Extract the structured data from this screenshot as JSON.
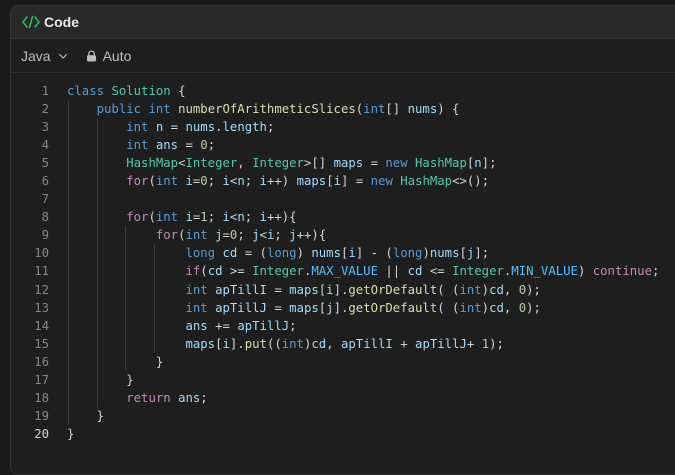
{
  "header": {
    "title": "Code",
    "icon": "code-brackets-icon",
    "icon_color": "#2cbb5d"
  },
  "toolbar": {
    "language": "Java",
    "mode": "Auto"
  },
  "colors": {
    "keyword": "#569cd6",
    "type": "#4ec9b0",
    "function": "#dcdcaa",
    "variable": "#9cdcfe",
    "number": "#b5cea8",
    "control": "#c586c0"
  },
  "editor": {
    "active_line": 20,
    "lines": [
      {
        "n": "1",
        "indent": 0,
        "tokens": [
          [
            "kw",
            "class"
          ],
          [
            "pl",
            " "
          ],
          [
            "ty",
            "Solution"
          ],
          [
            "pl",
            " {"
          ]
        ]
      },
      {
        "n": "2",
        "indent": 1,
        "tokens": [
          [
            "kw",
            "public"
          ],
          [
            "pl",
            " "
          ],
          [
            "kw",
            "int"
          ],
          [
            "pl",
            " "
          ],
          [
            "fn",
            "numberOfArithmeticSlices"
          ],
          [
            "pl",
            "("
          ],
          [
            "kw",
            "int"
          ],
          [
            "pl",
            "[] "
          ],
          [
            "va",
            "nums"
          ],
          [
            "pl",
            ") {"
          ]
        ]
      },
      {
        "n": "3",
        "indent": 2,
        "tokens": [
          [
            "kw",
            "int"
          ],
          [
            "pl",
            " "
          ],
          [
            "va",
            "n"
          ],
          [
            "pl",
            " = "
          ],
          [
            "va",
            "nums"
          ],
          [
            "pl",
            "."
          ],
          [
            "va",
            "length"
          ],
          [
            "pl",
            ";"
          ]
        ]
      },
      {
        "n": "4",
        "indent": 2,
        "tokens": [
          [
            "kw",
            "int"
          ],
          [
            "pl",
            " "
          ],
          [
            "va",
            "ans"
          ],
          [
            "pl",
            " = "
          ],
          [
            "nu",
            "0"
          ],
          [
            "pl",
            ";"
          ]
        ]
      },
      {
        "n": "5",
        "indent": 2,
        "tokens": [
          [
            "ty",
            "HashMap"
          ],
          [
            "pl",
            "<"
          ],
          [
            "ty",
            "Integer"
          ],
          [
            "pl",
            ", "
          ],
          [
            "ty",
            "Integer"
          ],
          [
            "pl",
            ">[] "
          ],
          [
            "va",
            "maps"
          ],
          [
            "pl",
            " = "
          ],
          [
            "kw",
            "new"
          ],
          [
            "pl",
            " "
          ],
          [
            "ty",
            "HashMap"
          ],
          [
            "pl",
            "["
          ],
          [
            "va",
            "n"
          ],
          [
            "pl",
            "];"
          ]
        ]
      },
      {
        "n": "6",
        "indent": 2,
        "tokens": [
          [
            "ct",
            "for"
          ],
          [
            "pl",
            "("
          ],
          [
            "kw",
            "int"
          ],
          [
            "pl",
            " "
          ],
          [
            "va",
            "i"
          ],
          [
            "pl",
            "="
          ],
          [
            "nu",
            "0"
          ],
          [
            "pl",
            "; "
          ],
          [
            "va",
            "i"
          ],
          [
            "pl",
            "<"
          ],
          [
            "va",
            "n"
          ],
          [
            "pl",
            "; "
          ],
          [
            "va",
            "i"
          ],
          [
            "pl",
            "++) "
          ],
          [
            "va",
            "maps"
          ],
          [
            "pl",
            "["
          ],
          [
            "va",
            "i"
          ],
          [
            "pl",
            "] = "
          ],
          [
            "kw",
            "new"
          ],
          [
            "pl",
            " "
          ],
          [
            "ty",
            "HashMap"
          ],
          [
            "pl",
            "<>();"
          ]
        ]
      },
      {
        "n": "7",
        "indent": 2,
        "tokens": []
      },
      {
        "n": "8",
        "indent": 2,
        "tokens": [
          [
            "ct",
            "for"
          ],
          [
            "pl",
            "("
          ],
          [
            "kw",
            "int"
          ],
          [
            "pl",
            " "
          ],
          [
            "va",
            "i"
          ],
          [
            "pl",
            "="
          ],
          [
            "nu",
            "1"
          ],
          [
            "pl",
            "; "
          ],
          [
            "va",
            "i"
          ],
          [
            "pl",
            "<"
          ],
          [
            "va",
            "n"
          ],
          [
            "pl",
            "; "
          ],
          [
            "va",
            "i"
          ],
          [
            "pl",
            "++){"
          ]
        ]
      },
      {
        "n": "9",
        "indent": 3,
        "tokens": [
          [
            "ct",
            "for"
          ],
          [
            "pl",
            "("
          ],
          [
            "kw",
            "int"
          ],
          [
            "pl",
            " "
          ],
          [
            "va",
            "j"
          ],
          [
            "pl",
            "="
          ],
          [
            "nu",
            "0"
          ],
          [
            "pl",
            "; "
          ],
          [
            "va",
            "j"
          ],
          [
            "pl",
            "<"
          ],
          [
            "va",
            "i"
          ],
          [
            "pl",
            "; "
          ],
          [
            "va",
            "j"
          ],
          [
            "pl",
            "++){"
          ]
        ]
      },
      {
        "n": "10",
        "indent": 4,
        "tokens": [
          [
            "kw",
            "long"
          ],
          [
            "pl",
            " "
          ],
          [
            "va",
            "cd"
          ],
          [
            "pl",
            " = ("
          ],
          [
            "kw",
            "long"
          ],
          [
            "pl",
            ") "
          ],
          [
            "va",
            "nums"
          ],
          [
            "pl",
            "["
          ],
          [
            "va",
            "i"
          ],
          [
            "pl",
            "] - ("
          ],
          [
            "kw",
            "long"
          ],
          [
            "pl",
            ")"
          ],
          [
            "va",
            "nums"
          ],
          [
            "pl",
            "["
          ],
          [
            "va",
            "j"
          ],
          [
            "pl",
            "];"
          ]
        ]
      },
      {
        "n": "11",
        "indent": 4,
        "tokens": [
          [
            "ct",
            "if"
          ],
          [
            "pl",
            "("
          ],
          [
            "va",
            "cd"
          ],
          [
            "pl",
            " >= "
          ],
          [
            "ty",
            "Integer"
          ],
          [
            "pl",
            "."
          ],
          [
            "co",
            "MAX_VALUE"
          ],
          [
            "pl",
            " || "
          ],
          [
            "va",
            "cd"
          ],
          [
            "pl",
            " <= "
          ],
          [
            "ty",
            "Integer"
          ],
          [
            "pl",
            "."
          ],
          [
            "co",
            "MIN_VALUE"
          ],
          [
            "pl",
            ") "
          ],
          [
            "ct",
            "continue"
          ],
          [
            "pl",
            ";"
          ]
        ]
      },
      {
        "n": "12",
        "indent": 4,
        "tokens": [
          [
            "kw",
            "int"
          ],
          [
            "pl",
            " "
          ],
          [
            "va",
            "apTillI"
          ],
          [
            "pl",
            " = "
          ],
          [
            "va",
            "maps"
          ],
          [
            "pl",
            "["
          ],
          [
            "va",
            "i"
          ],
          [
            "pl",
            "]."
          ],
          [
            "fn",
            "getOrDefault"
          ],
          [
            "pl",
            "( ("
          ],
          [
            "kw",
            "int"
          ],
          [
            "pl",
            ")"
          ],
          [
            "va",
            "cd"
          ],
          [
            "pl",
            ", "
          ],
          [
            "nu",
            "0"
          ],
          [
            "pl",
            ");"
          ]
        ]
      },
      {
        "n": "13",
        "indent": 4,
        "tokens": [
          [
            "kw",
            "int"
          ],
          [
            "pl",
            " "
          ],
          [
            "va",
            "apTillJ"
          ],
          [
            "pl",
            " = "
          ],
          [
            "va",
            "maps"
          ],
          [
            "pl",
            "["
          ],
          [
            "va",
            "j"
          ],
          [
            "pl",
            "]."
          ],
          [
            "fn",
            "getOrDefault"
          ],
          [
            "pl",
            "( ("
          ],
          [
            "kw",
            "int"
          ],
          [
            "pl",
            ")"
          ],
          [
            "va",
            "cd"
          ],
          [
            "pl",
            ", "
          ],
          [
            "nu",
            "0"
          ],
          [
            "pl",
            ");"
          ]
        ]
      },
      {
        "n": "14",
        "indent": 4,
        "tokens": [
          [
            "va",
            "ans"
          ],
          [
            "pl",
            " += "
          ],
          [
            "va",
            "apTillJ"
          ],
          [
            "pl",
            ";"
          ]
        ]
      },
      {
        "n": "15",
        "indent": 4,
        "tokens": [
          [
            "va",
            "maps"
          ],
          [
            "pl",
            "["
          ],
          [
            "va",
            "i"
          ],
          [
            "pl",
            "]."
          ],
          [
            "fn",
            "put"
          ],
          [
            "pl",
            "(("
          ],
          [
            "kw",
            "int"
          ],
          [
            "pl",
            ")"
          ],
          [
            "va",
            "cd"
          ],
          [
            "pl",
            ", "
          ],
          [
            "va",
            "apTillI"
          ],
          [
            "pl",
            " + "
          ],
          [
            "va",
            "apTillJ"
          ],
          [
            "pl",
            "+ "
          ],
          [
            "nu",
            "1"
          ],
          [
            "pl",
            ");"
          ]
        ]
      },
      {
        "n": "16",
        "indent": 3,
        "tokens": [
          [
            "pl",
            "}"
          ]
        ]
      },
      {
        "n": "17",
        "indent": 2,
        "tokens": [
          [
            "pl",
            "}"
          ]
        ]
      },
      {
        "n": "18",
        "indent": 2,
        "tokens": [
          [
            "ct",
            "return"
          ],
          [
            "pl",
            " "
          ],
          [
            "va",
            "ans"
          ],
          [
            "pl",
            ";"
          ]
        ]
      },
      {
        "n": "19",
        "indent": 1,
        "tokens": [
          [
            "pl",
            "}"
          ]
        ]
      },
      {
        "n": "20",
        "indent": 0,
        "tokens": [
          [
            "pl",
            "}"
          ]
        ]
      }
    ]
  }
}
